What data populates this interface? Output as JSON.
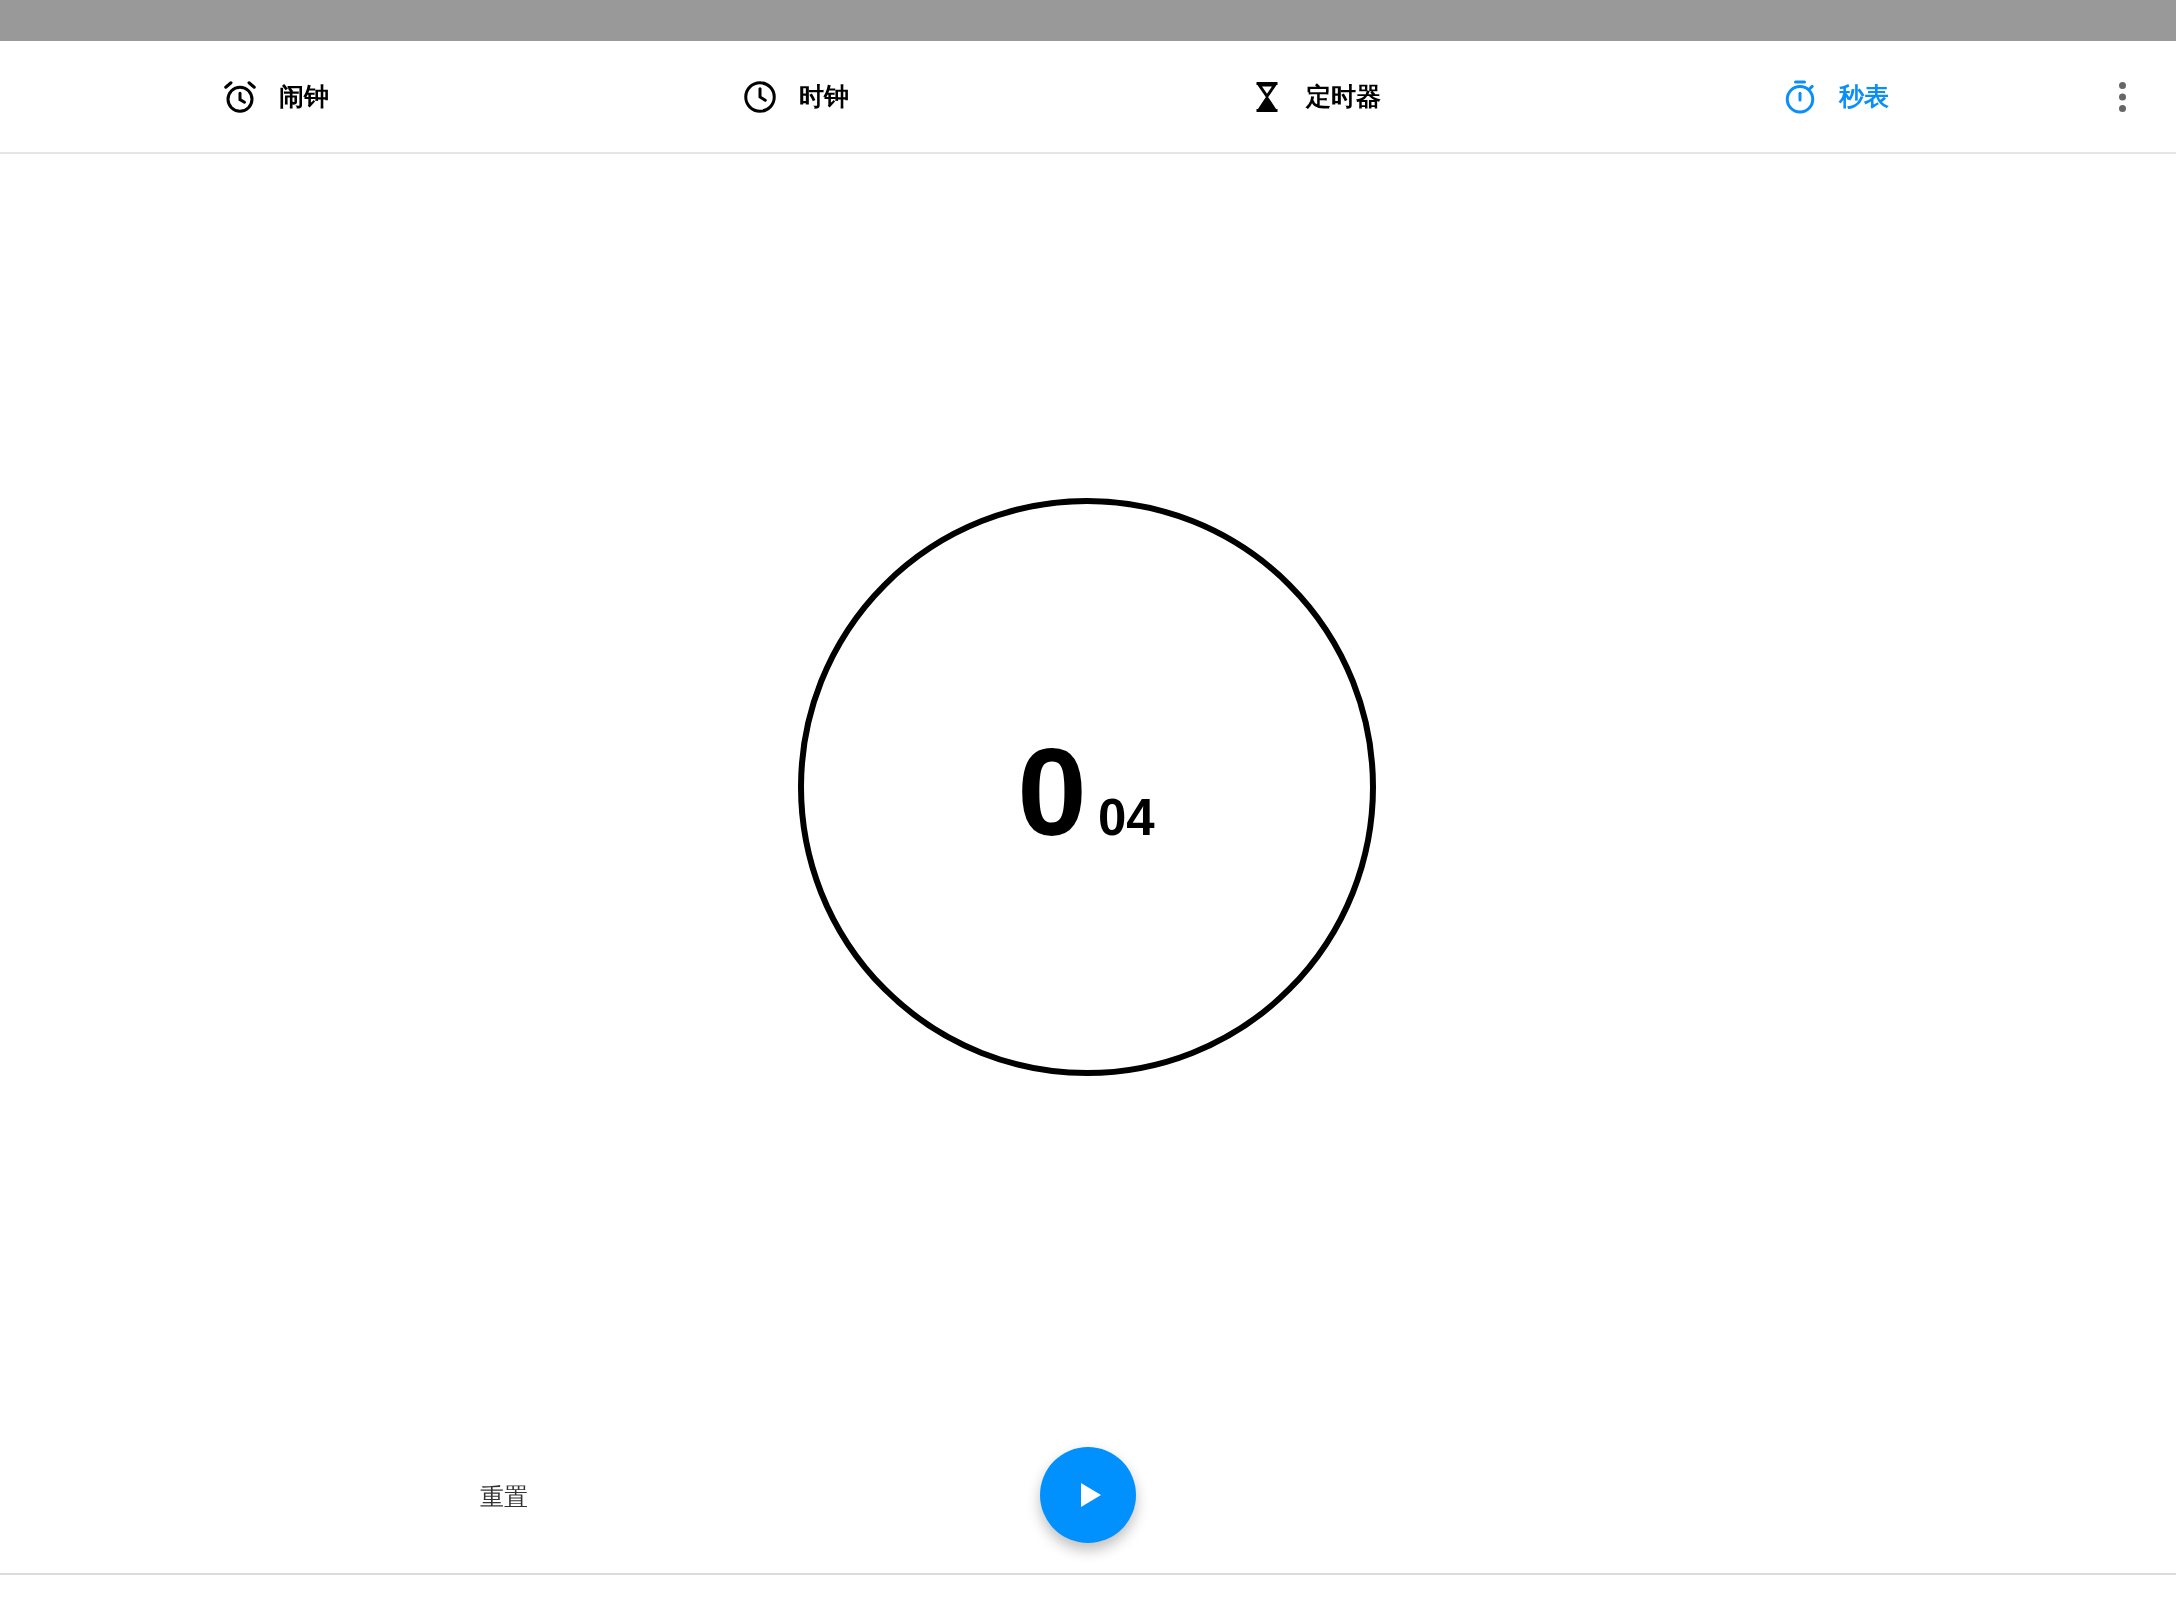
{
  "tabs": [
    {
      "label": "闹钟",
      "selected": false
    },
    {
      "label": "时钟",
      "selected": false
    },
    {
      "label": "定时器",
      "selected": false
    },
    {
      "label": "秒表",
      "selected": true
    }
  ],
  "stopwatch": {
    "seconds": "0",
    "fraction": "04"
  },
  "controls": {
    "reset": "重置"
  }
}
